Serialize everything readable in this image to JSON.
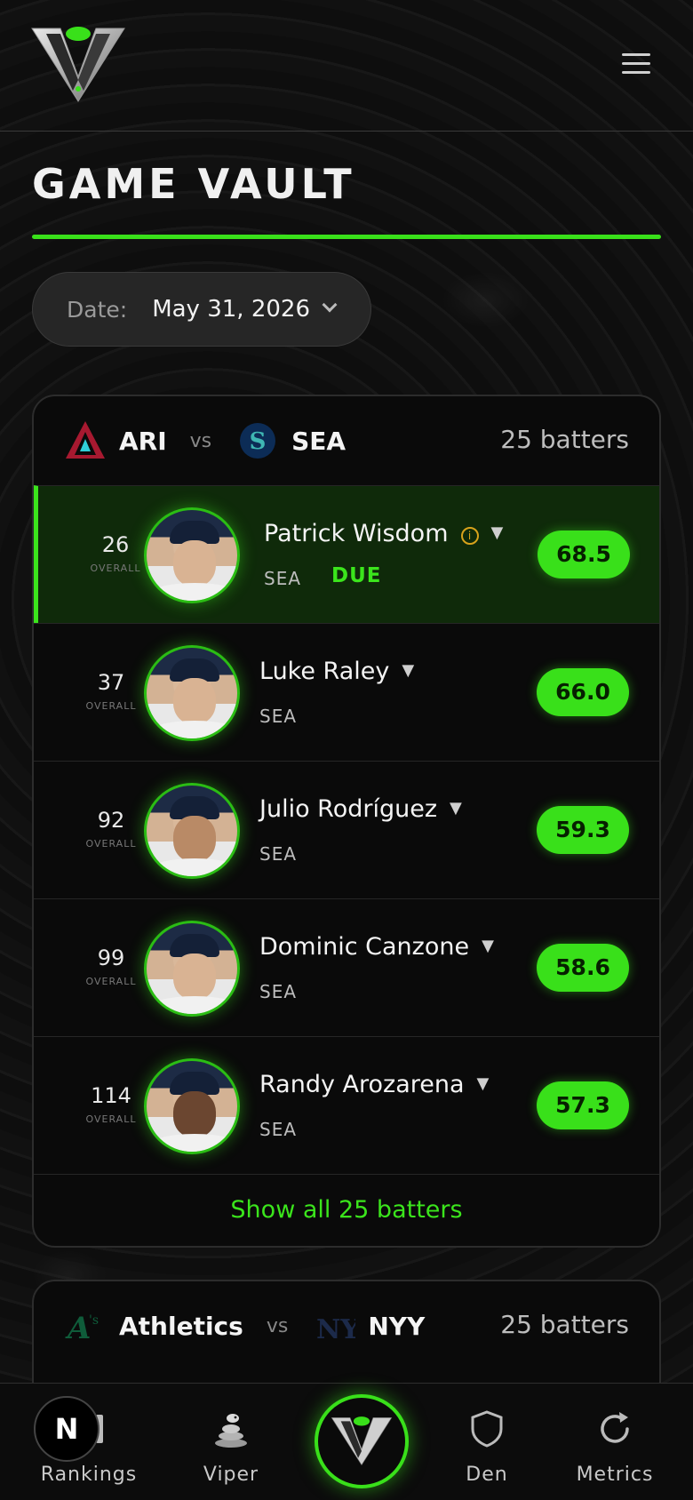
{
  "header": {
    "logo_icon": "viper-v-logo",
    "menu_icon": "hamburger-menu-icon"
  },
  "page": {
    "title": "GAME VAULT"
  },
  "date_filter": {
    "label": "Date:",
    "value": "May 31, 2026"
  },
  "games": [
    {
      "home": "ARI",
      "away": "SEA",
      "vs": "vs",
      "batters_count": "25 batters",
      "players": [
        {
          "rank": "26",
          "rank_label": "OVERALL",
          "name": "Patrick Wisdom",
          "team": "SEA",
          "tag": "DUE",
          "info": "i",
          "score": "68.5"
        },
        {
          "rank": "37",
          "rank_label": "OVERALL",
          "name": "Luke Raley",
          "team": "SEA",
          "score": "66.0"
        },
        {
          "rank": "92",
          "rank_label": "OVERALL",
          "name": "Julio Rodríguez",
          "team": "SEA",
          "score": "59.3"
        },
        {
          "rank": "99",
          "rank_label": "OVERALL",
          "name": "Dominic Canzone",
          "team": "SEA",
          "score": "58.6"
        },
        {
          "rank": "114",
          "rank_label": "OVERALL",
          "name": "Randy Arozarena",
          "team": "SEA",
          "score": "57.3"
        }
      ],
      "show_all": "Show all 25 batters"
    },
    {
      "home": "Athletics",
      "away": "NYY",
      "vs": "vs",
      "batters_count": "25 batters"
    }
  ],
  "nav": {
    "badge": "N",
    "items": [
      {
        "label": "Rankings",
        "icon": "rankings-icon"
      },
      {
        "label": "Viper",
        "icon": "snake-icon"
      },
      {
        "label": "",
        "icon": "viper-v-logo"
      },
      {
        "label": "Den",
        "icon": "shield-icon"
      },
      {
        "label": "Metrics",
        "icon": "refresh-icon"
      }
    ]
  },
  "colors": {
    "accent": "#39e01a",
    "background": "#0b0b0b",
    "highlight_row": "#0f2a0a",
    "info": "#d7a21b"
  }
}
